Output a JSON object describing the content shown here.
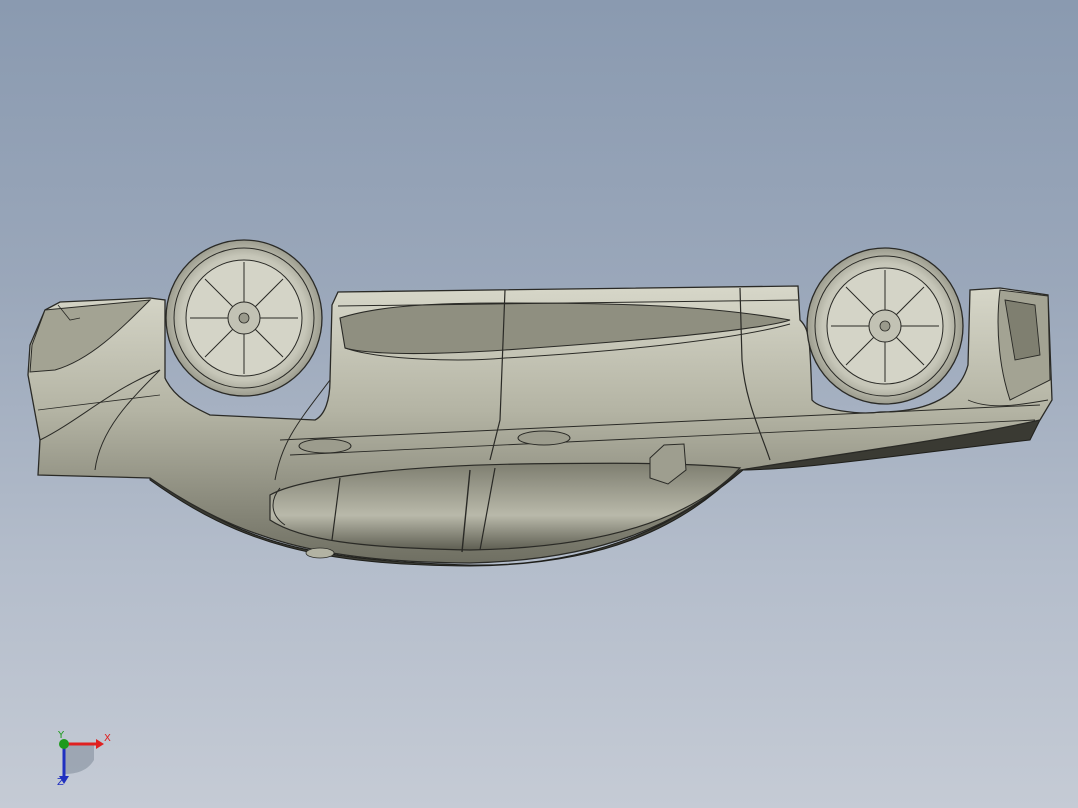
{
  "viewport": {
    "background_top": "#8a9ab0",
    "background_bottom": "#c5cbd5"
  },
  "model": {
    "body_color": "#b7b7a8",
    "edge_color": "#2a2a26",
    "shade_color": "#6b6b60"
  },
  "triad": {
    "x_label": "X",
    "y_label": "Y",
    "z_label": "Z",
    "x_color": "#e02020",
    "y_color": "#1c9a1c",
    "z_color": "#2030c0"
  }
}
